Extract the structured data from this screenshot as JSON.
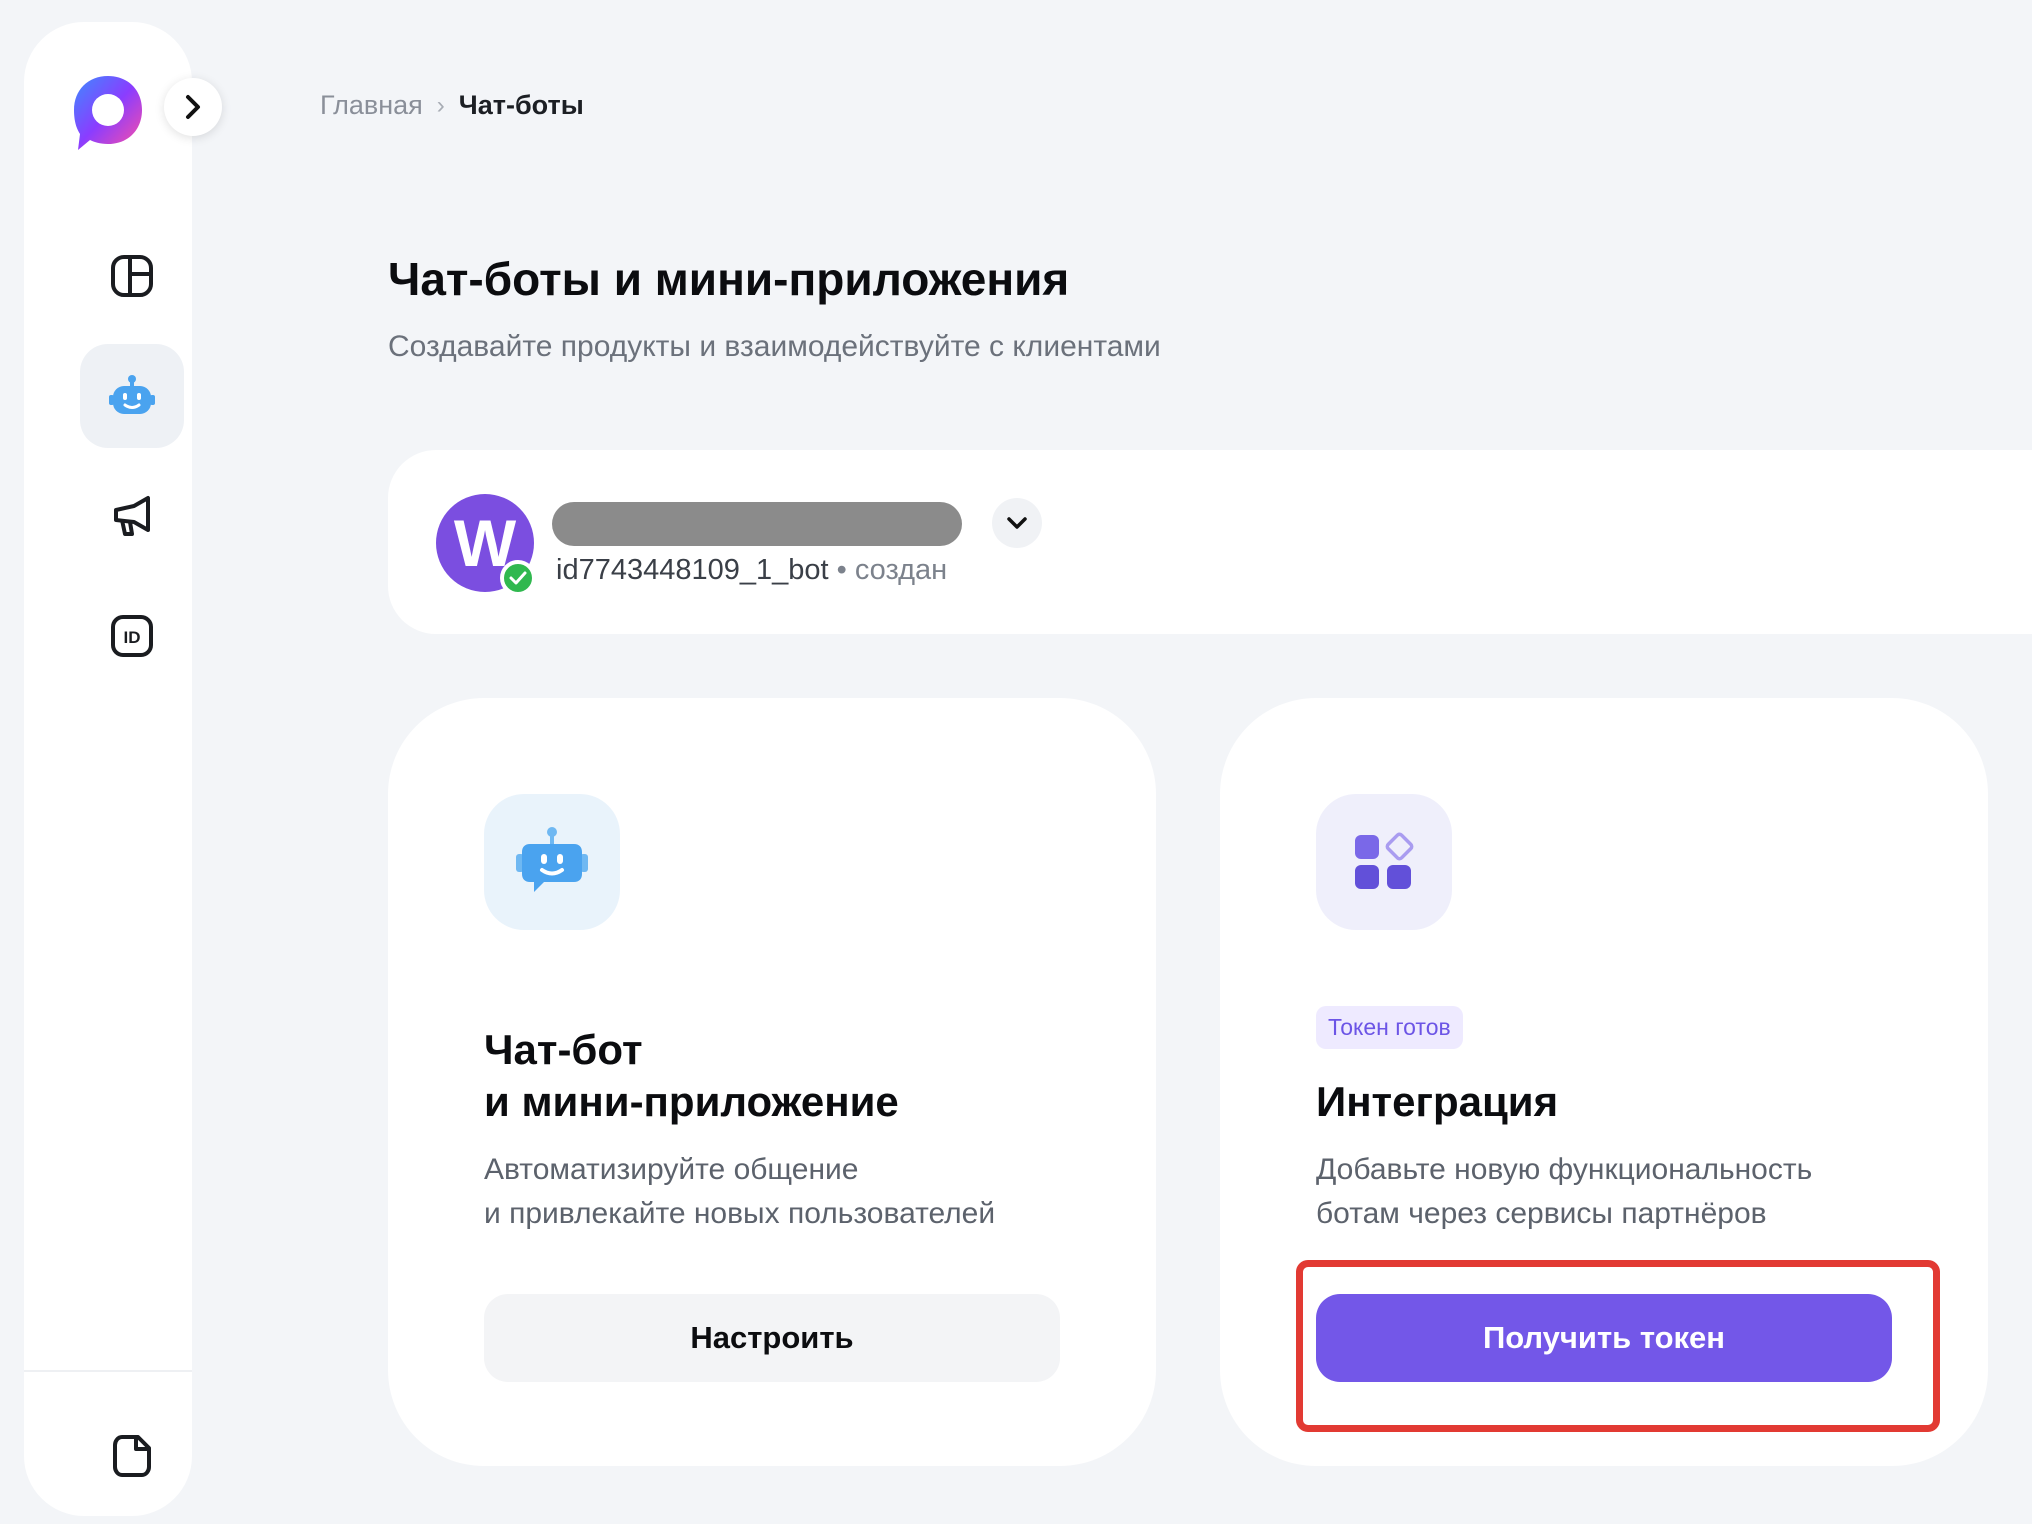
{
  "breadcrumb": {
    "home": "Главная",
    "separator": "›",
    "current": "Чат-боты"
  },
  "page": {
    "title": "Чат-боты и мини-приложения",
    "subtitle": "Создавайте продукты и взаимодействуйте с клиентами"
  },
  "sidebar": {
    "items": [
      {
        "name": "dashboard",
        "icon": "dashboard-icon",
        "active": false
      },
      {
        "name": "chatbots",
        "icon": "bot-icon",
        "active": true
      },
      {
        "name": "promotion",
        "icon": "megaphone-icon",
        "active": false
      },
      {
        "name": "id",
        "icon": "id-card-icon",
        "active": false
      }
    ],
    "bottom_icon": "document-icon"
  },
  "bot": {
    "avatar_letter": "W",
    "id": "id7743448109_1_bot",
    "status_separator": "•",
    "status": "создан"
  },
  "cards": {
    "chatbot": {
      "title_line1": "Чат-бот",
      "title_line2": "и мини-приложение",
      "desc_line1": "Автоматизируйте общение",
      "desc_line2": "и привлекайте новых пользователей",
      "button": "Настроить"
    },
    "integration": {
      "badge": "Токен готов",
      "title": "Интеграция",
      "desc_line1": "Добавьте новую функциональность",
      "desc_line2": "ботам через сервисы партнёров",
      "button": "Получить токен"
    }
  },
  "colors": {
    "accent": "#7357e8",
    "highlight": "#e23a33",
    "background": "#f3f5f8",
    "verified": "#30b84f"
  }
}
